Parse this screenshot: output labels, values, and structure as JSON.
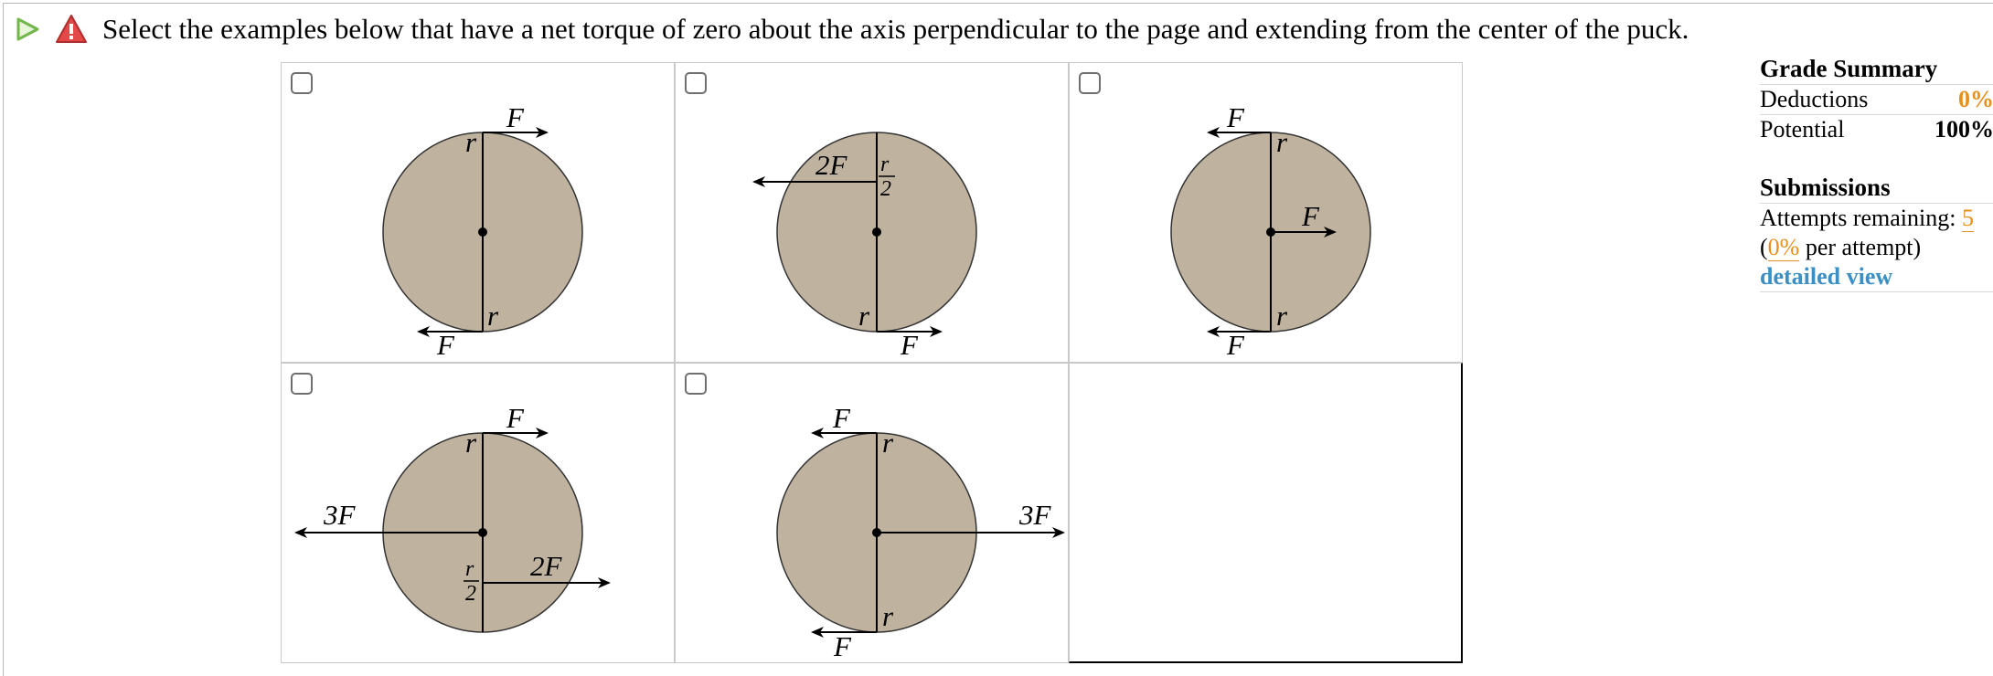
{
  "question": {
    "prompt": "Select the examples below that have a net torque of zero about the axis perpendicular to the page and extending from the center of the puck.",
    "status_icons": [
      "play-icon",
      "warning-icon"
    ]
  },
  "labels": {
    "F": "F",
    "r": "r",
    "two_F": "2F",
    "three_F": "3F",
    "half_num": "r",
    "half_den": "2"
  },
  "options": [
    {
      "id": "option-1",
      "checked": false
    },
    {
      "id": "option-2",
      "checked": false
    },
    {
      "id": "option-3",
      "checked": false
    },
    {
      "id": "option-4",
      "checked": false
    },
    {
      "id": "option-5",
      "checked": false
    }
  ],
  "grade_summary": {
    "title": "Grade Summary",
    "deductions_label": "Deductions",
    "deductions_value": "0%",
    "potential_label": "Potential",
    "potential_value": "100%"
  },
  "submissions": {
    "title": "Submissions",
    "attempts_label": "Attempts remaining: ",
    "attempts_value": "5",
    "per_attempt_open": "(",
    "per_attempt_value": "0%",
    "per_attempt_suffix": " per attempt)",
    "detailed_view": "detailed view"
  },
  "colors": {
    "puck": "#bfb3a0",
    "accent_orange": "#e8901e",
    "link_blue": "#3b8fc4"
  }
}
